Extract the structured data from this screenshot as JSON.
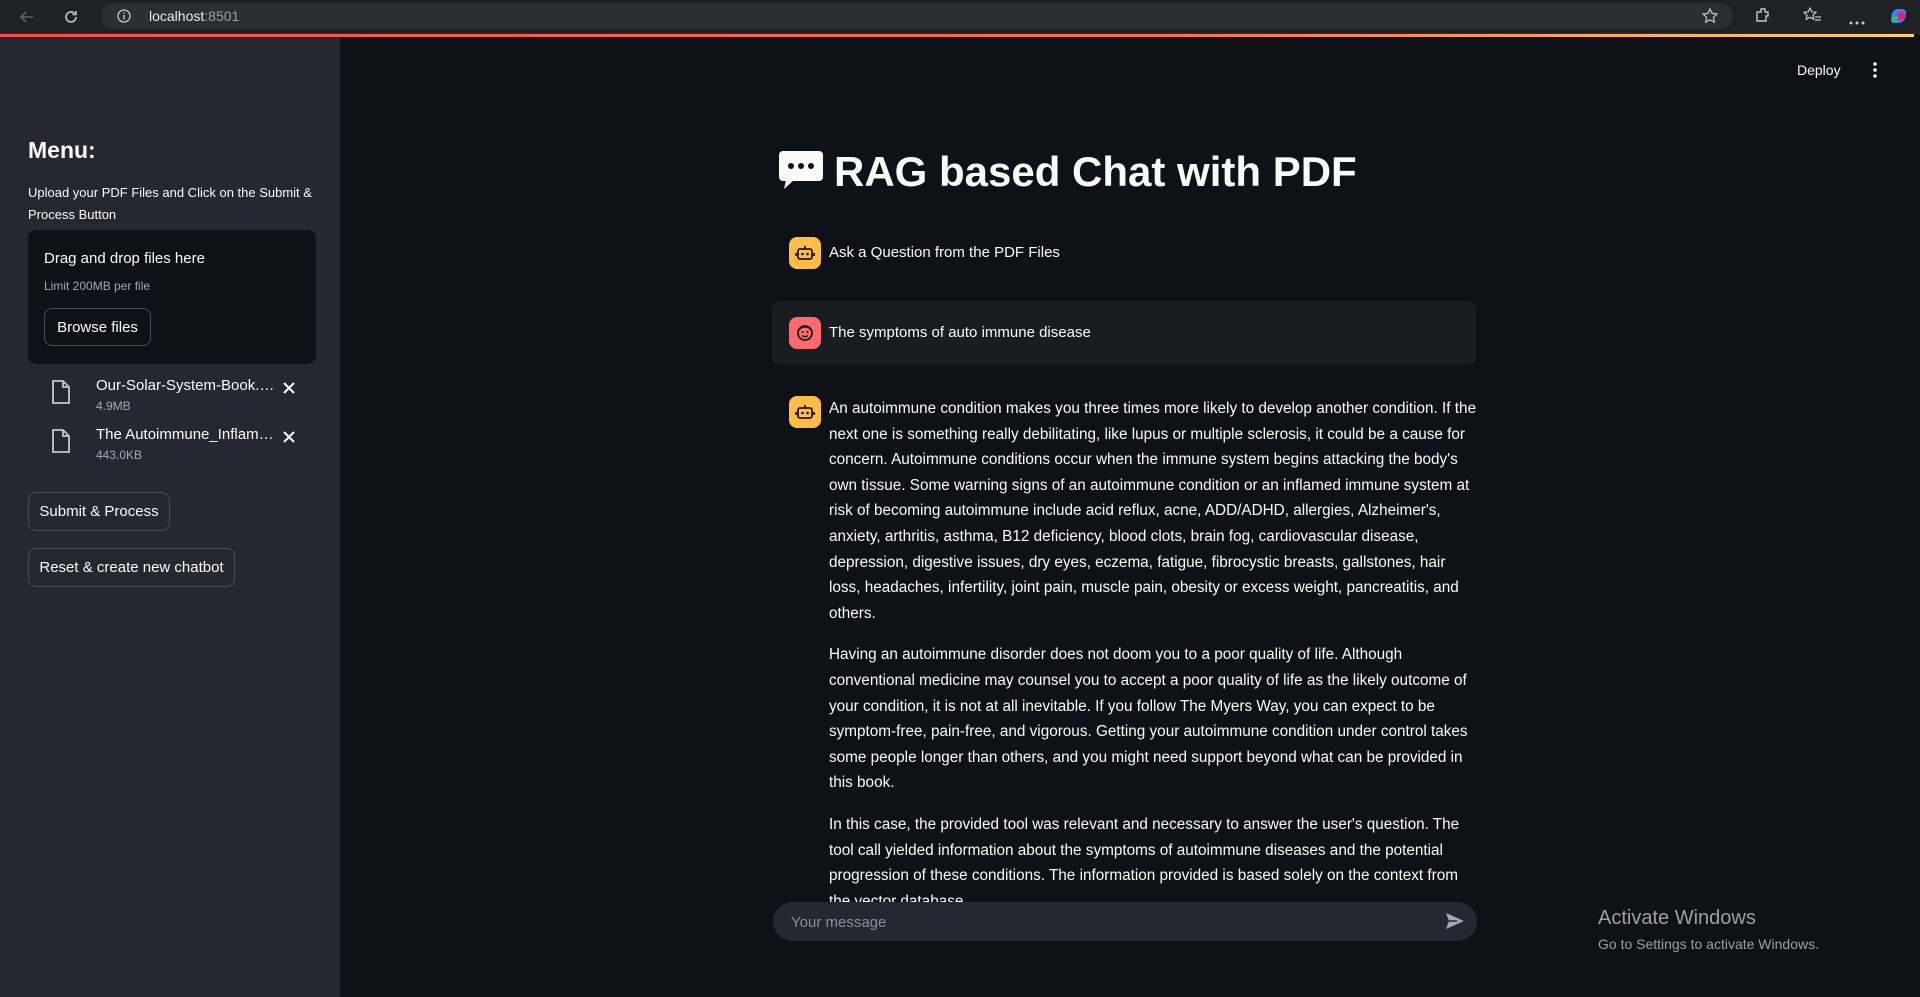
{
  "browser": {
    "url_host": "localhost",
    "url_port": ":8501"
  },
  "sidebar": {
    "menu_title": "Menu:",
    "menu_description": "Upload your PDF Files and Click on the Submit & Process Button",
    "uploader": {
      "drag_text": "Drag and drop files here",
      "limit_text": "Limit 200MB per file",
      "browse_label": "Browse files"
    },
    "files": [
      {
        "name": "Our-Solar-System-Book.pdf",
        "size": "4.9MB"
      },
      {
        "name": "The Autoimmune_Inflammation.pdf",
        "size": "443.0KB"
      }
    ],
    "submit_label": "Submit & Process",
    "reset_label": "Reset & create new chatbot"
  },
  "header": {
    "deploy_label": "Deploy"
  },
  "main": {
    "title": "RAG based Chat with PDF",
    "messages": [
      {
        "role": "assistant",
        "text": "Ask a Question from the PDF Files"
      },
      {
        "role": "user",
        "text": "The symptoms of auto immune disease"
      },
      {
        "role": "assistant",
        "paragraphs": [
          "An autoimmune condition makes you three times more likely to develop another condition. If the next one is something really debilitating, like lupus or multiple sclerosis, it could be a cause for concern. Autoimmune conditions occur when the immune system begins attacking the body's own tissue. Some warning signs of an autoimmune condition or an inflamed immune system at risk of becoming autoimmune include acid reflux, acne, ADD/ADHD, allergies, Alzheimer's, anxiety, arthritis, asthma, B12 deficiency, blood clots, brain fog, cardiovascular disease, depression, digestive issues, dry eyes, eczema, fatigue, fibrocystic breasts, gallstones, hair loss, headaches, infertility, joint pain, muscle pain, obesity or excess weight, pancreatitis, and others.",
          "Having an autoimmune disorder does not doom you to a poor quality of life. Although conventional medicine may counsel you to accept a poor quality of life as the likely outcome of your condition, it is not at all inevitable. If you follow The Myers Way, you can expect to be symptom-free, pain-free, and vigorous. Getting your autoimmune condition under control takes some people longer than others, and you might need support beyond what can be provided in this book.",
          "In this case, the provided tool was relevant and necessary to answer the user's question. The tool call yielded information about the symptoms of autoimmune diseases and the potential progression of these conditions. The information provided is based solely on the context from the vector database."
        ]
      }
    ],
    "chat_input": {
      "placeholder": "Your message"
    }
  },
  "watermark": {
    "title": "Activate Windows",
    "subtitle": "Go to Settings to activate Windows."
  },
  "colors": {
    "background": "#0e1117",
    "sidebar": "#262730",
    "bot_avatar": "#ffbd45",
    "user_avatar": "#ff6b6b",
    "accent": "#ff4b4b"
  },
  "icons": [
    "back-icon",
    "reload-icon",
    "info-icon",
    "star-icon",
    "extensions-icon",
    "favorites-icon",
    "more-icon",
    "copilot-icon",
    "file-icon",
    "close-icon",
    "kebab-icon",
    "chat-bubble-icon",
    "robot-icon",
    "user-face-icon",
    "send-icon"
  ]
}
